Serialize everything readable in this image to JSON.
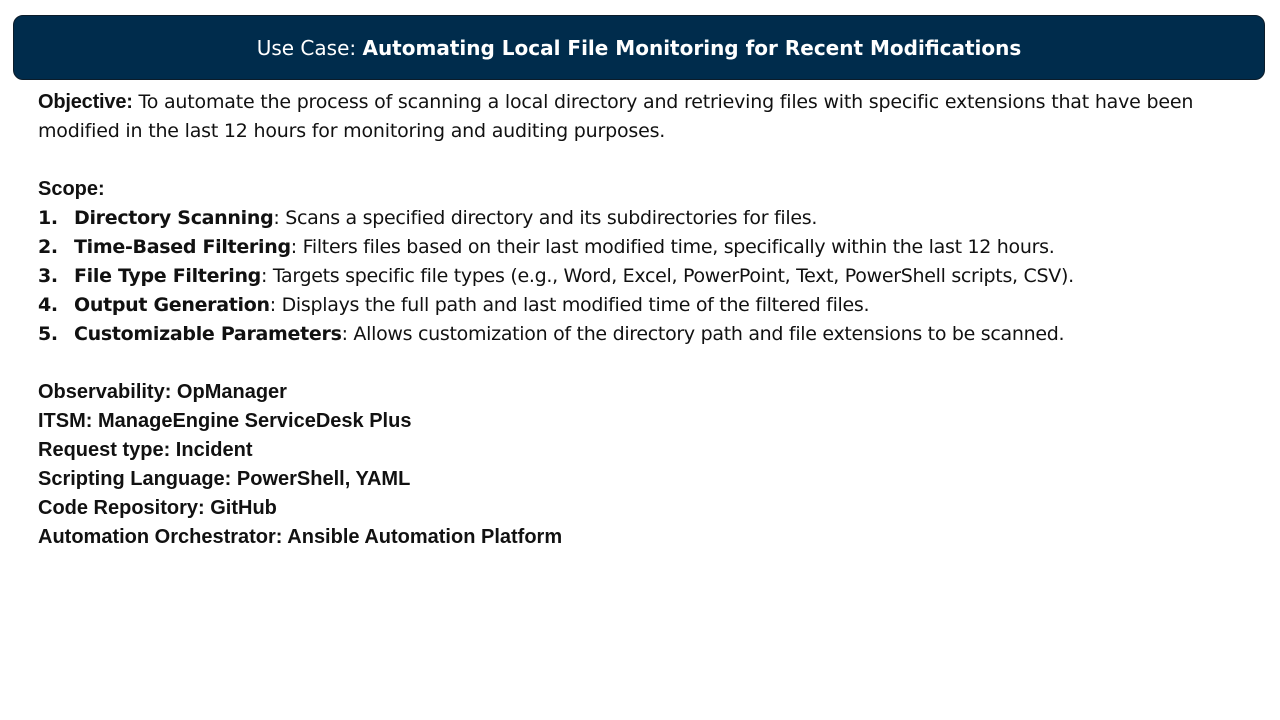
{
  "title": {
    "prefix": "Use Case: ",
    "main": "Automating Local File Monitoring for Recent Modifications"
  },
  "objective": {
    "label": "Objective:",
    "text": " To automate the process of scanning a local directory and retrieving files with specific extensions that have been modified in the last 12 hours for monitoring and auditing purposes."
  },
  "scope": {
    "heading": "Scope:",
    "items": [
      {
        "num": "1.",
        "term": "Directory Scanning",
        "desc": ": Scans a specified directory and its subdirectories for files."
      },
      {
        "num": "2.",
        "term": "Time-Based Filtering",
        "desc": ": Filters files based on their last modified time, specifically within the last 12 hours."
      },
      {
        "num": "3.",
        "term": "File Type Filtering",
        "desc": ": Targets specific file types (e.g., Word, Excel, PowerPoint, Text, PowerShell scripts, CSV)."
      },
      {
        "num": "4.",
        "term": "Output Generation",
        "desc": ": Displays the full path and last modified time of the filtered files."
      },
      {
        "num": "5.",
        "term": "Customizable Parameters",
        "desc": ": Allows customization of the directory path and file extensions to be scanned."
      }
    ]
  },
  "meta": {
    "observability": "Observability: OpManager",
    "itsm": "ITSM: ManageEngine ServiceDesk Plus",
    "request_type": "Request type: Incident",
    "scripting_language": "Scripting Language: PowerShell, YAML",
    "code_repository": "Code Repository: GitHub",
    "automation_orchestrator": "Automation Orchestrator: Ansible Automation Platform"
  },
  "colors": {
    "title_bar_bg": "#002c4c",
    "title_text": "#ffffff",
    "body_text": "#111111"
  }
}
